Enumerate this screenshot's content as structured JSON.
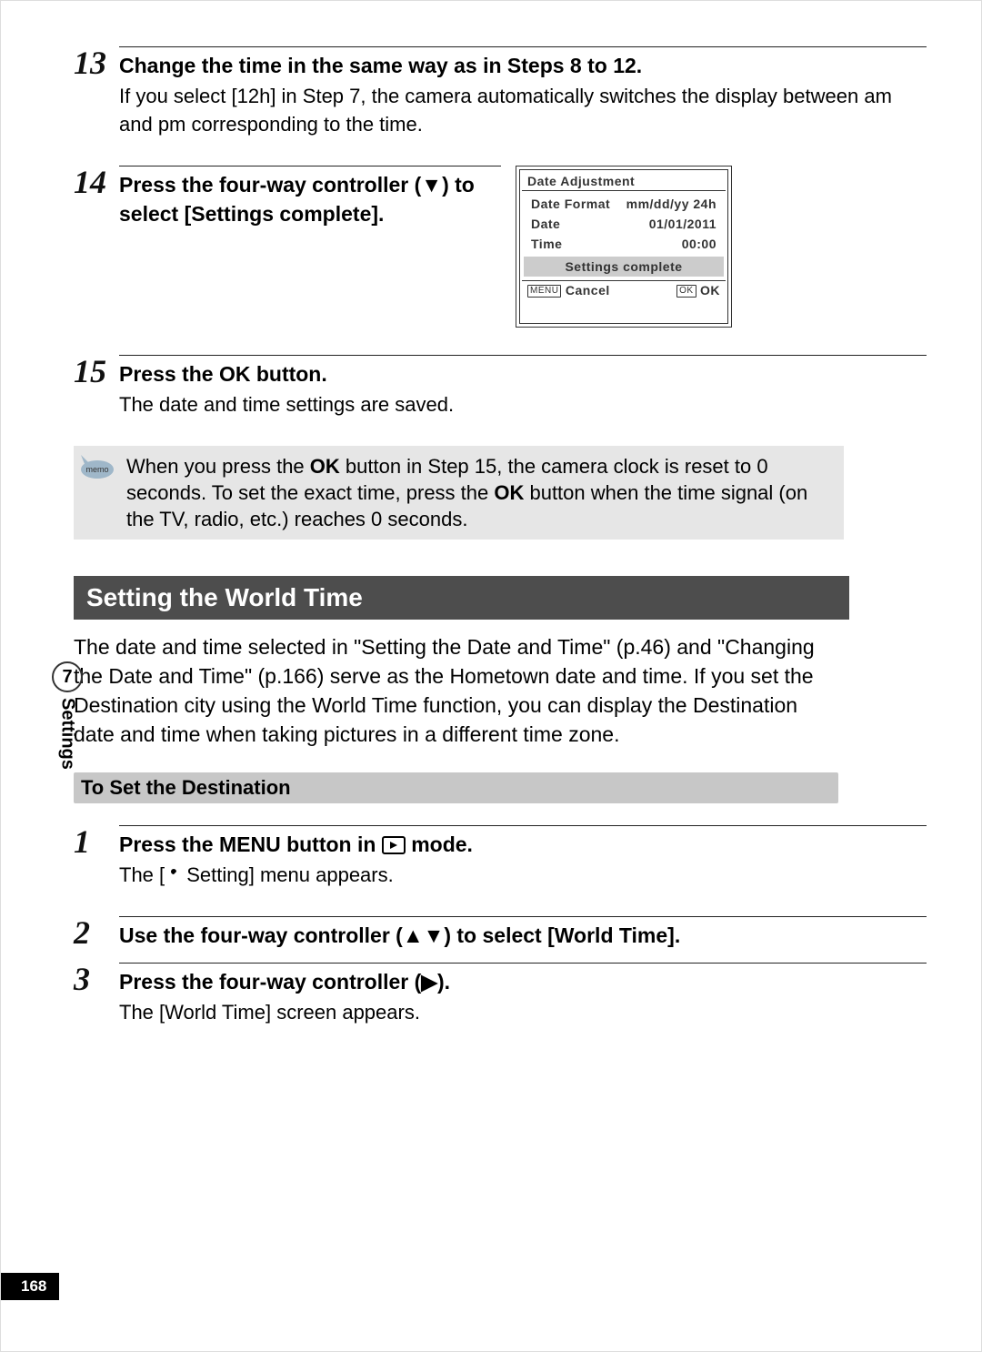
{
  "steps_top": {
    "s13": {
      "num": "13",
      "title": "Change the time in the same way as in Steps 8 to 12.",
      "desc": "If you select [12h] in Step 7, the camera automatically switches the display between am and pm corresponding to the time."
    },
    "s14": {
      "num": "14",
      "title": "Press the four-way controller (▼) to select [Settings complete]."
    },
    "s15": {
      "num": "15",
      "title_pre": "Press the ",
      "title_ok": "OK",
      "title_post": " button.",
      "desc": "The date and time settings are saved."
    }
  },
  "screen": {
    "header": "Date Adjustment",
    "rows": [
      {
        "label": "Date Format",
        "value": "mm/dd/yy 24h"
      },
      {
        "label": "Date",
        "value": "01/01/2011"
      },
      {
        "label": "Time",
        "value": "00:00"
      }
    ],
    "selected": "Settings complete",
    "footer_left_box": "MENU",
    "footer_left_text": "Cancel",
    "footer_right_box": "OK",
    "footer_right_text": "OK"
  },
  "memo": {
    "pre": "When you press the ",
    "ok1": "OK",
    "mid1": " button in Step 15, the camera clock is reset to 0 seconds. To set the exact time, press the ",
    "ok2": "OK",
    "mid2": " button when the time signal (on the TV, radio, etc.) reaches 0 seconds.",
    "icon_label": "memo"
  },
  "section": {
    "title": "Setting the World Time",
    "para": "The date and time selected in \"Setting the Date and Time\" (p.46) and \"Changing the Date and Time\" (p.166) serve as the Hometown date and time. If you set the Destination city using the World Time function, you can display the Destination date and time when taking pictures in a different time zone.",
    "sub_title": "To Set the Destination"
  },
  "steps_bottom": {
    "s1": {
      "num": "1",
      "title_pre": "Press the ",
      "title_bold": "MENU",
      "title_mid": " button in ",
      "title_post": " mode.",
      "desc_pre": "The [",
      "desc_post": " Setting] menu appears."
    },
    "s2": {
      "num": "2",
      "title": "Use the four-way controller (▲▼) to select [World Time]."
    },
    "s3": {
      "num": "3",
      "title": "Press the four-way controller (▶).",
      "desc": "The [World Time] screen appears."
    }
  },
  "side": {
    "num": "7",
    "label": "Settings"
  },
  "page_num": "168"
}
